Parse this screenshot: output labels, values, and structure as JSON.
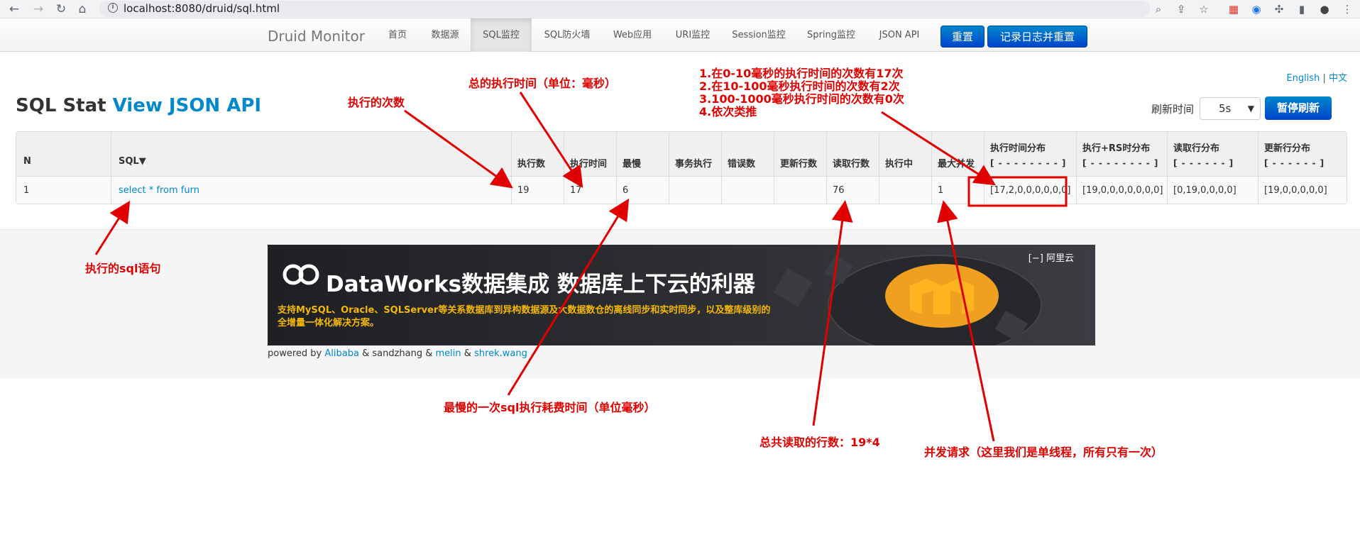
{
  "browser": {
    "url": "localhost:8080/druid/sql.html"
  },
  "navbar": {
    "brand": "Druid Monitor",
    "items": [
      "首页",
      "数据源",
      "SQL监控",
      "SQL防火墙",
      "Web应用",
      "URI监控",
      "Session监控",
      "Spring监控",
      "JSON API"
    ],
    "active_index": 2,
    "reset_label": "重置",
    "log_reset_label": "记录日志并重置"
  },
  "lang": {
    "english": "English",
    "separator": "|",
    "chinese": "中文"
  },
  "heading": {
    "title": "SQL Stat",
    "json_link": "View JSON API"
  },
  "refresh": {
    "label": "刷新时间",
    "value": "5s",
    "pause_label": "暂停刷新"
  },
  "table": {
    "headers": [
      "N",
      "SQL▼",
      "执行数",
      "执行时间",
      "最慢",
      "事务执行",
      "错误数",
      "更新行数",
      "读取行数",
      "执行中",
      "最大并发",
      "执行时间分布",
      "执行+RS时分布",
      "读取行分布",
      "更新行分布"
    ],
    "subheaders": {
      "h11": "[ - - - - - - - - ]",
      "h12": "[ - - - - - - - - ]",
      "h13": "[ - - - - - - ]",
      "h14": "[ - - - - - - ]"
    },
    "rows": [
      {
        "n": "1",
        "sql": "select * from furn",
        "exec_count": "19",
        "exec_time": "17",
        "slowest": "6",
        "txn": "",
        "errors": "",
        "update_rows": "",
        "read_rows": "76",
        "running": "",
        "max_concurrent": "1",
        "exec_hist": "[17,2,0,0,0,0,0,0]",
        "exec_rs_hist": "[19,0,0,0,0,0,0,0]",
        "read_hist": "[0,19,0,0,0,0]",
        "update_hist": "[19,0,0,0,0,0]"
      }
    ]
  },
  "banner": {
    "title": "DataWorks数据集成 数据库上下云的利器",
    "desc": "支持MySQL、Oracle、SQLServer等关系数据库到异构数据源及大数据数仓的离线同步和实时同步，以及整库级别的全增量一体化解决方案。",
    "logo_text": "阿里云"
  },
  "powered": {
    "prefix": "powered by",
    "alibaba": "Alibaba",
    "mid": "& sandzhang &",
    "melin": "melin",
    "amp": "&",
    "shrek": "shrek.wang"
  },
  "annotations": {
    "exec_count": "执行的次数",
    "total_time": "总的执行时间（单位：毫秒）",
    "hist_1": "1.在0-10毫秒的执行时间的次数有17次",
    "hist_2": "2.在10-100毫秒执行时间的次数有2次",
    "hist_3": "3.100-1000毫秒执行时间的次数有0次",
    "hist_4": "4.依次类推",
    "sql": "执行的sql语句",
    "slowest": "最慢的一次sql执行耗费时间（单位毫秒）",
    "read_rows": "总共读取的行数：19*4",
    "concurrent": "并发请求（这里我们是单线程，所有只有一次）"
  },
  "colors": {
    "accent": "#0088cc",
    "annotation": "#e00000"
  }
}
